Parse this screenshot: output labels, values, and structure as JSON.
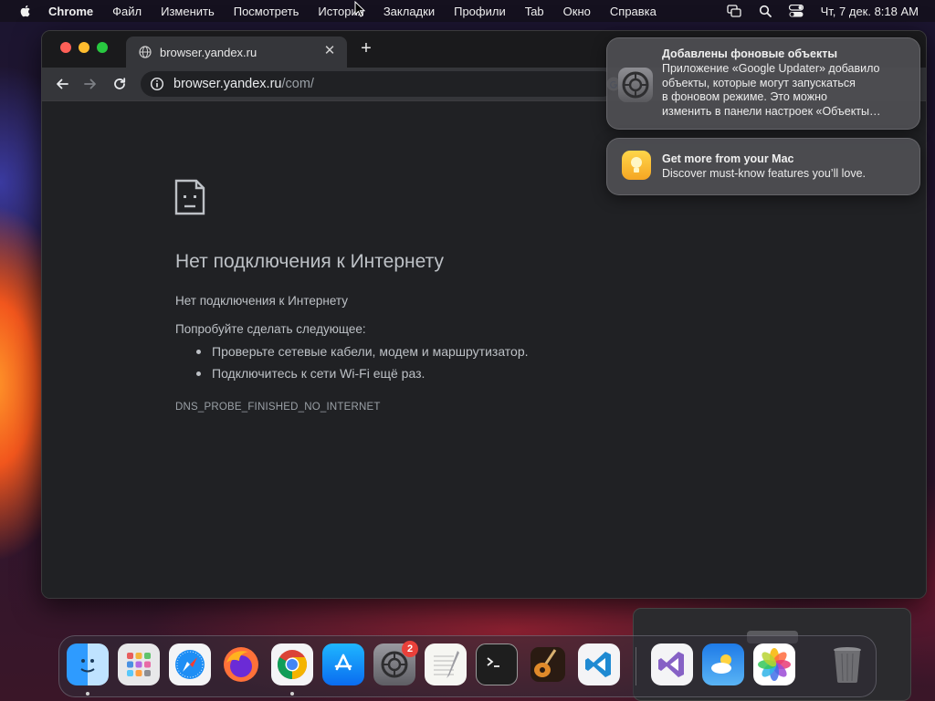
{
  "menubar": {
    "app_name": "Chrome",
    "items": [
      "Файл",
      "Изменить",
      "Посмотреть",
      "История",
      "Закладки",
      "Профили",
      "Tab",
      "Окно",
      "Справка"
    ],
    "clock": "Чт, 7 дек.  8:18 AM"
  },
  "browser": {
    "tab_title": "browser.yandex.ru",
    "url_host": "browser.yandex.ru",
    "url_path": "/com/"
  },
  "error_page": {
    "title": "Нет подключения к Интернету",
    "subtitle": "Нет подключения к Интернету",
    "try_label": "Попробуйте сделать следующее:",
    "suggestions": [
      "Проверьте сетевые кабели, модем и маршрутизатор.",
      "Подключитесь к сети Wi-Fi ещё раз."
    ],
    "error_code": "DNS_PROBE_FINISHED_NO_INTERNET"
  },
  "notifications": [
    {
      "title": "Добавлены фоновые объекты",
      "body_lines": [
        "Приложение «Google Updater» добавило",
        "объекты, которые могут запускаться",
        "в фоновом режиме. Это можно",
        "изменить в панели настроек «Объекты…"
      ],
      "icon": "system-settings-icon"
    },
    {
      "title": "Get more from your Mac",
      "body_lines": [
        "Discover must-know features you’ll love."
      ],
      "icon": "tips-lightbulb-icon"
    }
  ],
  "dock": {
    "items": [
      {
        "name": "finder",
        "icon": "finder-icon",
        "running": true
      },
      {
        "name": "launchpad",
        "icon": "launchpad-icon",
        "running": false
      },
      {
        "name": "safari",
        "icon": "safari-icon",
        "running": false
      },
      {
        "name": "firefox",
        "icon": "firefox-icon",
        "running": false
      },
      {
        "name": "chrome",
        "icon": "chrome-icon",
        "running": true
      },
      {
        "name": "app-store",
        "icon": "app-store-icon",
        "running": false
      },
      {
        "name": "system-settings",
        "icon": "system-settings-icon",
        "running": false
      },
      {
        "name": "textedit",
        "icon": "textedit-icon",
        "running": false
      },
      {
        "name": "terminal",
        "icon": "terminal-icon",
        "running": false
      },
      {
        "name": "garageband",
        "icon": "garageband-icon",
        "running": false
      },
      {
        "name": "vscode",
        "icon": "vscode-icon",
        "running": false
      },
      {
        "name": "visual-studio",
        "icon": "visual-studio-icon",
        "running": false
      },
      {
        "name": "weather",
        "icon": "weather-icon",
        "running": false
      },
      {
        "name": "photos",
        "icon": "photos-icon",
        "running": false
      },
      {
        "name": "trash",
        "icon": "trash-icon",
        "running": false
      }
    ],
    "settings_badge": "2"
  },
  "colors": {
    "traffic_red": "#ff5f57",
    "traffic_yellow": "#febc2e",
    "traffic_green": "#28c840",
    "page_bg": "#202124",
    "error_text": "#bdc1c6"
  }
}
